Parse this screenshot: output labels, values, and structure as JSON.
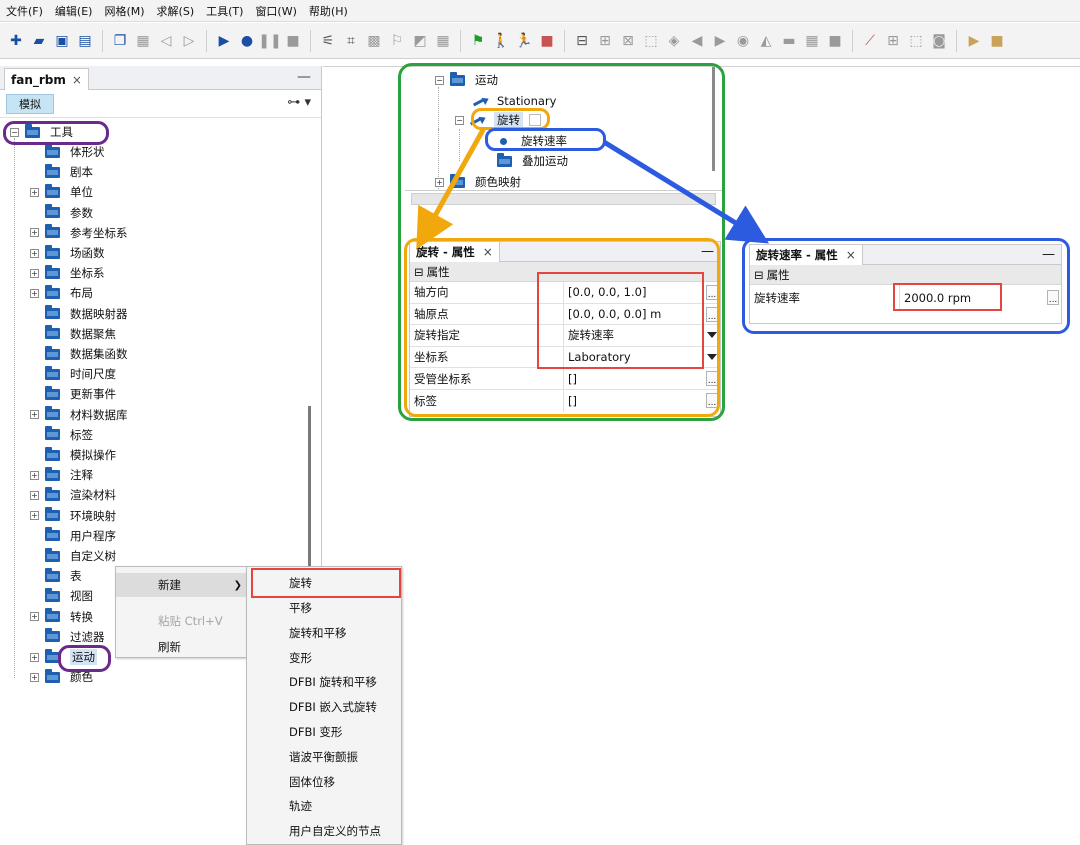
{
  "menubar": {
    "items": [
      "文件(F)",
      "编辑(E)",
      "网格(M)",
      "求解(S)",
      "工具(T)",
      "窗口(W)",
      "帮助(H)"
    ]
  },
  "left_panel": {
    "tab_label": "fan_rbm",
    "close_glyph": "×",
    "minimize_glyph": "—",
    "sub_tab": "模拟",
    "tree_root": "工具",
    "tree_items": [
      "体形状",
      "剧本",
      "单位",
      "参数",
      "参考坐标系",
      "场函数",
      "坐标系",
      "布局",
      "数据映射器",
      "数据聚焦",
      "数据集函数",
      "时间尺度",
      "更新事件",
      "材料数据库",
      "标签",
      "模拟操作",
      "注释",
      "渲染材料",
      "环境映射",
      "用户程序",
      "自定义树",
      "表",
      "视图",
      "转换",
      "过滤器",
      "运动",
      "颜色"
    ]
  },
  "context_menu": {
    "new_label": "新建",
    "paste_label": "粘贴 Ctrl+V",
    "refresh_label": "刷新",
    "submenu": [
      "旋转",
      "平移",
      "旋转和平移",
      "变形",
      "DFBI 旋转和平移",
      "DFBI 嵌入式旋转",
      "DFBI 变形",
      "谐波平衡颤振",
      "固体位移",
      "轨迹",
      "用户自定义的节点"
    ]
  },
  "motion_tree": {
    "motion": "运动",
    "stationary": "Stationary",
    "rotation": "旋转",
    "rotation_rate": "旋转速率",
    "superposed": "叠加运动",
    "color_map": "颜色映射"
  },
  "rotation_properties": {
    "title": "旋转 - 属性",
    "section": "属性",
    "rows": [
      {
        "key": "轴方向",
        "value": "[0.0, 0.0, 1.0]"
      },
      {
        "key": "轴原点",
        "value": "[0.0, 0.0, 0.0] m"
      },
      {
        "key": "旋转指定",
        "value": "旋转速率"
      },
      {
        "key": "坐标系",
        "value": "Laboratory"
      },
      {
        "key": "受管坐标系",
        "value": "[]"
      },
      {
        "key": "标签",
        "value": "[]"
      }
    ]
  },
  "rate_properties": {
    "title": "旋转速率 - 属性",
    "section": "属性",
    "key": "旋转速率",
    "value": "2000.0 rpm"
  },
  "colors": {
    "annotation_green": "#2aa33e",
    "annotation_orange": "#f0a80c",
    "annotation_blue": "#2d5be0",
    "annotation_red": "#e4453f",
    "annotation_purple": "#6a2a8c",
    "folder_blue": "#1f5fb0"
  }
}
